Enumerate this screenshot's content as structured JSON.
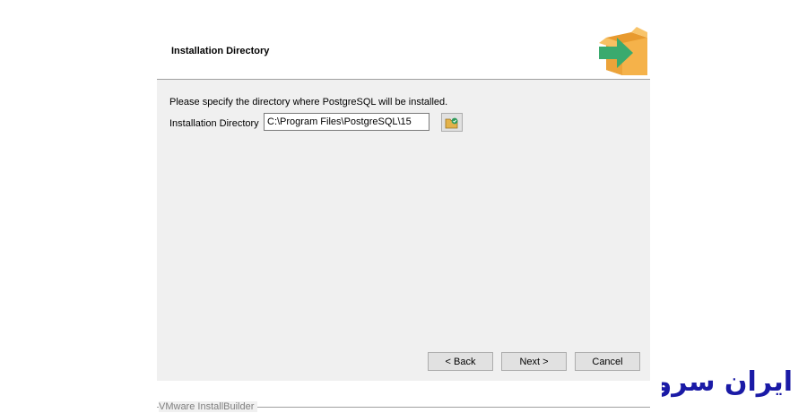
{
  "header": {
    "title": "Installation Directory",
    "logo_icon": "package-arrow-icon"
  },
  "content": {
    "description": "Please specify the directory where PostgreSQL will be installed.",
    "dir_label": "Installation Directory",
    "dir_value": "C:\\Program Files\\PostgreSQL\\15",
    "browse_icon": "folder-browse-icon"
  },
  "footer": {
    "branding": "VMware InstallBuilder",
    "back_label": "< Back",
    "next_label": "Next >",
    "cancel_label": "Cancel"
  },
  "watermark": {
    "brand_text": "ایران سرور",
    "color": "#1a1aa6"
  },
  "colors": {
    "window_bg": "#f0f0f0",
    "header_bg": "#ffffff",
    "box_orange": "#f5b24a",
    "arrow_green": "#3aaa6e"
  }
}
